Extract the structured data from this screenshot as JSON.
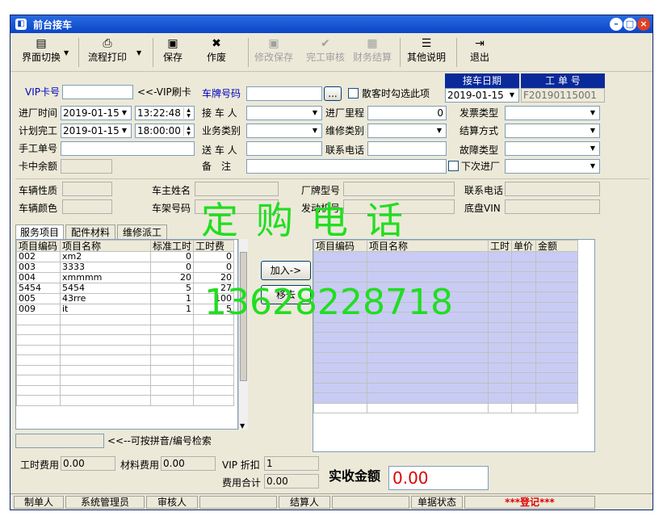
{
  "window": {
    "title": "前台接车",
    "min": "–",
    "max": "□",
    "close": "×"
  },
  "toolbar": [
    {
      "label": "界面切换",
      "icon": "layout-icon",
      "ic": "▤",
      "dis": false
    },
    {
      "label": "流程打印",
      "icon": "printer-icon",
      "ic": "⎙",
      "dis": false
    },
    {
      "label": "保存",
      "icon": "save-icon",
      "ic": "▣",
      "dis": false
    },
    {
      "label": "作废",
      "icon": "delete-x-icon",
      "ic": "✖",
      "dis": false
    },
    {
      "label": "修改保存",
      "icon": "edit-save-icon",
      "ic": "▣",
      "dis": true
    },
    {
      "label": "完工审核",
      "icon": "check-icon",
      "ic": "✔",
      "dis": true
    },
    {
      "label": "财务结算",
      "icon": "calculator-icon",
      "ic": "▦",
      "dis": true
    },
    {
      "label": "其他说明",
      "icon": "note-icon",
      "ic": "☰",
      "dis": false
    },
    {
      "label": "退出",
      "icon": "exit-icon",
      "ic": "⇥",
      "dis": false
    }
  ],
  "form": {
    "vip_label": "VIP卡号",
    "vip_value": "",
    "vip_hint": "<<-VIP刷卡",
    "plate_label": "车牌号码",
    "plate_value": "",
    "plate_btn": "...",
    "casual_label": "散客时勾选此项",
    "recv_date_label": "接车日期",
    "recv_date": "2019-01-15",
    "order_label": "工 单 号",
    "order_no": "F20190115001",
    "entry_label": "进厂时间",
    "entry_date": "2019-01-15",
    "entry_time": "13:22:48",
    "plan_label": "计划完工",
    "plan_date": "2019-01-15",
    "plan_time": "18:00:00",
    "manual_label": "手工单号",
    "manual_value": "",
    "balance_label": "卡中余额",
    "balance_value": "",
    "receiver_label": "接 车 人",
    "biz_label": "业务类别",
    "sender_label": "送 车 人",
    "remark_label": "备　注",
    "mileage_label": "进厂里程",
    "mileage_value": "0",
    "repair_label": "维修类别",
    "phone_label": "联系电话",
    "invoice_label": "发票类型",
    "settle_label": "结算方式",
    "fault_label": "故障类型",
    "next_label": "下次进厂"
  },
  "vehicle": {
    "nature": "车辆性质",
    "color": "车辆颜色",
    "owner": "车主姓名",
    "frame": "车架号码",
    "brand": "厂牌型号",
    "engine": "发动机号",
    "phone": "联系电话",
    "vin": "底盘VIN"
  },
  "tabs": [
    "服务项目",
    "配件材料",
    "维修派工"
  ],
  "left_grid": {
    "headers": [
      "项目编码",
      "项目名称",
      "标准工时",
      "工时费"
    ],
    "rows": [
      [
        "002",
        "xm2",
        "0",
        "0"
      ],
      [
        "003",
        "3333",
        "0",
        "0"
      ],
      [
        "004",
        "xmmmm",
        "20",
        "20"
      ],
      [
        "5454",
        "5454",
        "5",
        "27"
      ],
      [
        "005",
        "43rre",
        "1",
        "100"
      ],
      [
        "009",
        "it",
        "1",
        "5"
      ]
    ]
  },
  "add_btn": "加入->",
  "remove_btn": "移去",
  "right_grid": {
    "headers": [
      "项目编码",
      "项目名称",
      "工时",
      "单价",
      "金额"
    ]
  },
  "search_hint": "<<--可按拼音/编号检索",
  "totals": {
    "labor_label": "工时费用",
    "labor_value": "0.00",
    "material_label": "材料费用",
    "material_value": "0.00",
    "vip_label": "VIP 折扣",
    "vip_value": "1",
    "fee_label": "费用合计",
    "fee_value": "0.00",
    "actual_label": "实收金额",
    "actual_value": "0.00"
  },
  "status": {
    "maker_label": "制单人",
    "maker": "系统管理员",
    "reviewer_label": "审核人",
    "reviewer": "",
    "settler_label": "结算人",
    "settler": "",
    "state_label": "单据状态",
    "state": "***登记***"
  },
  "watermark": {
    "text": "定购电话",
    "phone": "13628228718"
  },
  "colors": {
    "accent": "#0a2a9a",
    "watermark": "#22dd22",
    "total": "#e00000"
  }
}
